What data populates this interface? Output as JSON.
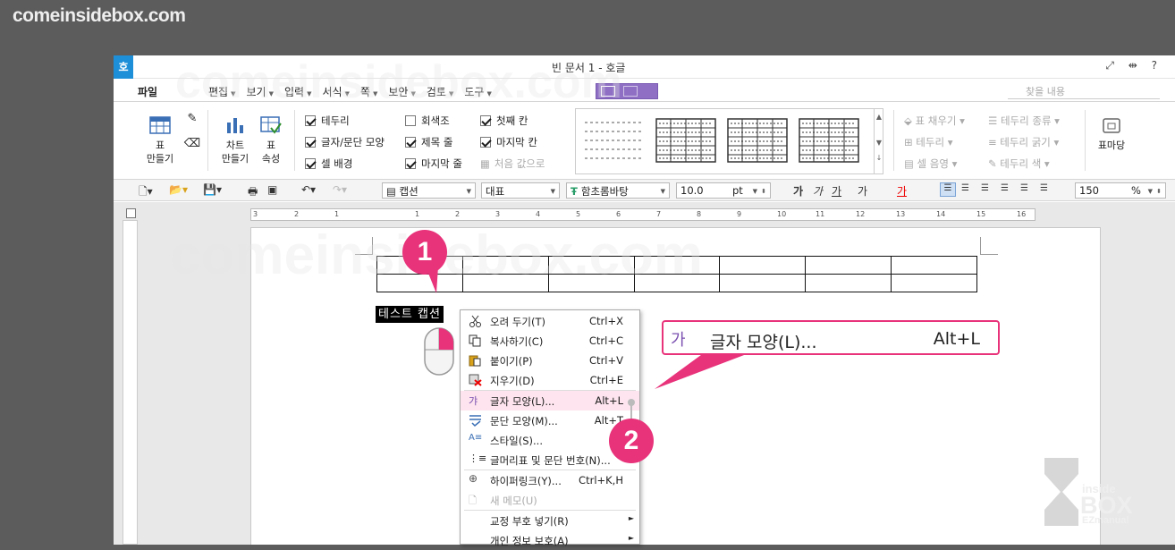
{
  "watermark": "comeinsidebox.com",
  "window": {
    "title": "빈 문서 1 - 호글",
    "app_icon": "호",
    "controls": "⤢ ⇹ ?"
  },
  "menu": {
    "file": "파일",
    "items": [
      "편집",
      "보기",
      "입력",
      "서식",
      "쪽",
      "보안",
      "검토",
      "도구"
    ],
    "search_placeholder": "찾을 내용"
  },
  "ribbon": {
    "table_btn": "표",
    "table_btn2": "만들기",
    "chart_btn": "차트",
    "chart_btn2": "만들기",
    "props_btn": "표",
    "props_btn2": "속성",
    "checks": [
      {
        "label": "테두리",
        "checked": true
      },
      {
        "label": "글자/문단 모양",
        "checked": true
      },
      {
        "label": "셀 배경",
        "checked": true
      },
      {
        "label": "회색조",
        "checked": false
      },
      {
        "label": "제목 줄",
        "checked": true
      },
      {
        "label": "마지막 줄",
        "checked": true
      },
      {
        "label": "첫째 칸",
        "checked": true
      },
      {
        "label": "마지막 칸",
        "checked": true
      }
    ],
    "reset": "처음 값으로",
    "right": [
      "표 채우기",
      "테두리",
      "셀 음영",
      "테두리 종류",
      "테두리 굵기",
      "테두리 색"
    ],
    "tabledrop": "표마당"
  },
  "toolbar": {
    "style": "캡션",
    "rep": "대표",
    "font": "함초롬바탕",
    "size": "10.0",
    "unit": "pt",
    "zoom": "150",
    "zoom_unit": "%",
    "fmt": [
      "가",
      "가",
      "가",
      "가",
      "가"
    ]
  },
  "ruler": [
    "3",
    "2",
    "1",
    "1",
    "2",
    "3",
    "4",
    "5",
    "6",
    "7",
    "8",
    "9",
    "10",
    "11",
    "12",
    "13",
    "14",
    "15",
    "16",
    "17"
  ],
  "document": {
    "caption": "테스트 캡션"
  },
  "badges": {
    "one": "1",
    "two": "2"
  },
  "context_menu": [
    {
      "label": "오려 두기(T)",
      "shortcut": "Ctrl+X",
      "icon": "scissors-icon"
    },
    {
      "label": "복사하기(C)",
      "shortcut": "Ctrl+C",
      "icon": "copy-icon"
    },
    {
      "label": "붙이기(P)",
      "shortcut": "Ctrl+V",
      "icon": "paste-icon"
    },
    {
      "label": "지우기(D)",
      "shortcut": "Ctrl+E",
      "icon": "delete-icon"
    },
    {
      "label": "글자 모양(L)...",
      "shortcut": "Alt+L",
      "icon": "char-shape-icon"
    },
    {
      "label": "문단 모양(M)...",
      "shortcut": "Alt+T",
      "icon": "para-shape-icon"
    },
    {
      "label": "스타일(S)...",
      "shortcut": "",
      "icon": "style-icon"
    },
    {
      "label": "글머리표 및 문단 번호(N)...",
      "shortcut": "",
      "icon": "bullet-icon"
    },
    {
      "label": "하이퍼링크(Y)...",
      "shortcut": "Ctrl+K,H",
      "icon": "hyperlink-icon"
    },
    {
      "label": "새 메모(U)",
      "shortcut": "",
      "icon": "memo-icon"
    },
    {
      "label": "교정 부호 넣기(R)",
      "shortcut": "",
      "icon": ""
    },
    {
      "label": "개인 정보 보호(A)",
      "shortcut": "",
      "icon": ""
    }
  ],
  "callout": {
    "icon": "가",
    "label": "글자 모양(L)...",
    "shortcut": "Alt+L"
  },
  "logo": {
    "line1": "inside",
    "line2": "BOX",
    "line3": "EZmanual"
  },
  "colors": {
    "accent": "#e8327a",
    "brand": "#1d8fd8",
    "purple": "#8e6fc4"
  }
}
